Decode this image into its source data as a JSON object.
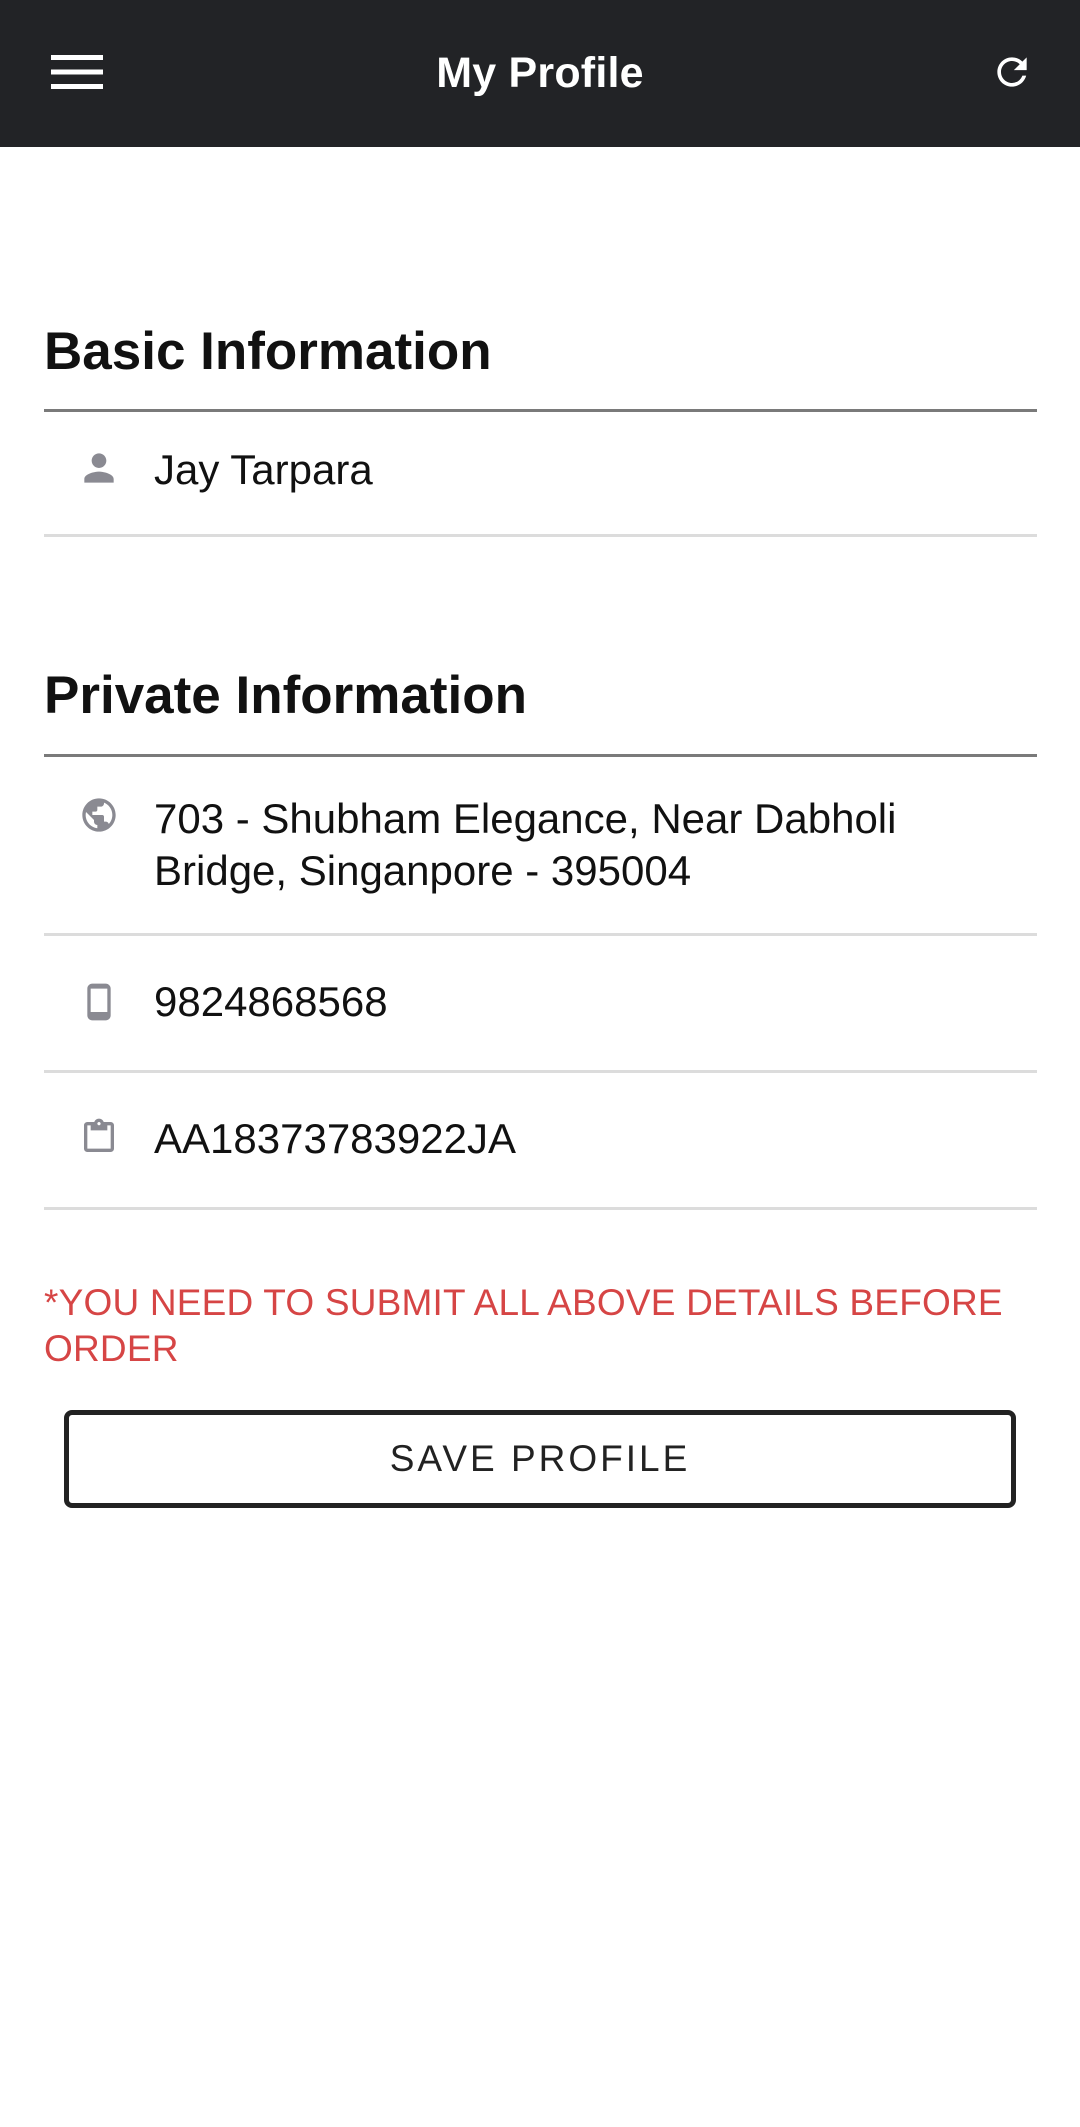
{
  "header": {
    "title": "My Profile",
    "menu_icon": "hamburger-menu-icon",
    "refresh_icon": "refresh-icon",
    "background": "#222326"
  },
  "basic_section": {
    "title": "Basic Information",
    "name": {
      "icon": "person-icon",
      "value": "Jay Tarpara"
    }
  },
  "private_section": {
    "title": "Private Information",
    "address": {
      "icon": "globe-icon",
      "value": "703 - Shubham Elegance, Near Dabholi Bridge, Singanpore - 395004"
    },
    "phone": {
      "icon": "mobile-phone-icon",
      "value": "9824868568"
    },
    "id_number": {
      "icon": "clipboard-icon",
      "value": "AA18373783922JA"
    }
  },
  "warning": {
    "text": "*YOU NEED TO SUBMIT ALL ABOVE DETAILS BEFORE ORDER",
    "color": "#d64545"
  },
  "actions": {
    "save_label": "SAVE PROFILE"
  }
}
